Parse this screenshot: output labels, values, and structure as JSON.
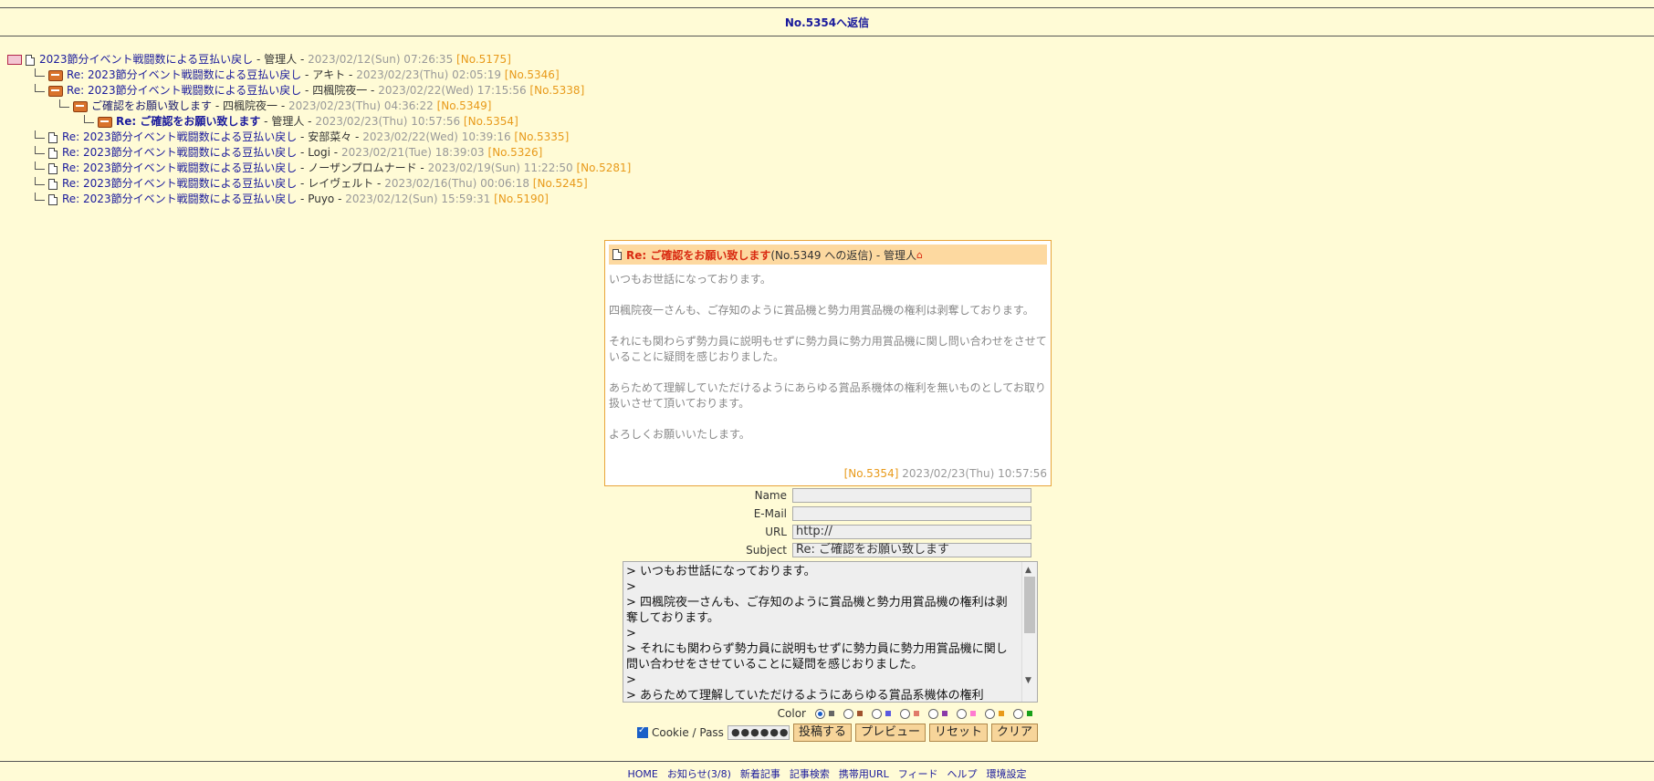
{
  "header": {
    "title": "No.5354へ返信"
  },
  "tree": [
    {
      "indent": 0,
      "icon": "book",
      "subject": "2023節分イベント戦闘数による豆払い戻し",
      "author": "管理人",
      "date": "2023/02/12(Sun) 07:26:35",
      "no": "[No.5175]",
      "style": ""
    },
    {
      "indent": 1,
      "icon": "mail",
      "subject": "Re: 2023節分イベント戦闘数による豆払い戻し",
      "author": "アキト",
      "date": "2023/02/23(Thu) 02:05:19",
      "no": "[No.5346]",
      "style": ""
    },
    {
      "indent": 1,
      "icon": "mail",
      "subject": "Re: 2023節分イベント戦闘数による豆払い戻し",
      "author": "四楓院夜一",
      "date": "2023/02/22(Wed) 17:15:56",
      "no": "[No.5338]",
      "style": ""
    },
    {
      "indent": 2,
      "icon": "mail",
      "subject": "ご確認をお願い致します",
      "author": "四楓院夜一",
      "date": "2023/02/23(Thu) 04:36:22",
      "no": "[No.5349]",
      "style": "plain"
    },
    {
      "indent": 3,
      "icon": "mail",
      "subject": "Re: ご確認をお願い致します",
      "author": "管理人",
      "date": "2023/02/23(Thu) 10:57:56",
      "no": "[No.5354]",
      "style": "cur"
    },
    {
      "indent": 1,
      "icon": "doc",
      "subject": "Re: 2023節分イベント戦闘数による豆払い戻し",
      "author": "安部菜々",
      "date": "2023/02/22(Wed) 10:39:16",
      "no": "[No.5335]",
      "style": ""
    },
    {
      "indent": 1,
      "icon": "doc",
      "subject": "Re: 2023節分イベント戦闘数による豆払い戻し",
      "author": "Logi",
      "date": "2023/02/21(Tue) 18:39:03",
      "no": "[No.5326]",
      "style": ""
    },
    {
      "indent": 1,
      "icon": "doc",
      "subject": "Re: 2023節分イベント戦闘数による豆払い戻し",
      "author": "ノーザンプロムナード",
      "date": "2023/02/19(Sun) 11:22:50",
      "no": "[No.5281]",
      "style": ""
    },
    {
      "indent": 1,
      "icon": "doc",
      "subject": "Re: 2023節分イベント戦闘数による豆払い戻し",
      "author": "レイヴェルト",
      "date": "2023/02/16(Thu) 00:06:18",
      "no": "[No.5245]",
      "style": ""
    },
    {
      "indent": 1,
      "icon": "doc",
      "subject": "Re: 2023節分イベント戦闘数による豆払い戻し",
      "author": "Puyo",
      "date": "2023/02/12(Sun) 15:59:31",
      "no": "[No.5190]",
      "style": ""
    }
  ],
  "article": {
    "subject": "Re: ご確認をお願い致します",
    "meta": " (No.5349 への返信) - 管理人 ",
    "home_icon": "⌂",
    "body": [
      "いつもお世話になっております。",
      "四楓院夜一さんも、ご存知のように賞品機と勢力用賞品機の権利は剥奪しております。",
      "それにも関わらず勢力員に説明もせずに勢力員に勢力用賞品機に関し問い合わせをさせていることに疑問を感じおりました。",
      "あらためて理解していただけるようにあらゆる賞品系機体の権利を無いものとしてお取り扱いさせて頂いております。",
      "よろしくお願いいたします。"
    ],
    "no": "[No.5354]",
    "date": "2023/02/23(Thu) 10:57:56"
  },
  "form": {
    "name_label": "Name",
    "email_label": "E-Mail",
    "url_label": "URL",
    "url_value": "http://",
    "subject_label": "Subject",
    "subject_value": "Re: ご確認をお願い致します",
    "comment_lines": [
      "> いつもお世話になっております。",
      ">",
      "> 四楓院夜一さんも、ご存知のように賞品機と勢力用賞品機の権利は剥奪しております。",
      ">",
      "> それにも関わらず勢力員に説明もせずに勢力員に勢力用賞品機に関し問い合わせをさせていることに疑問を感じおりました。",
      ">",
      "> あらためて理解していただけるようにあらゆる賞品系機体の権利"
    ],
    "color_label": "Color",
    "colors": [
      "#666666",
      "#a0522d",
      "#5a5ae0",
      "#e07a6a",
      "#8a3aa8",
      "#ff7ad0",
      "#e89a1a",
      "#18a018"
    ],
    "cookie_label": "Cookie / Pass",
    "pass_value": "●●●●●●",
    "buttons": {
      "post": "投稿する",
      "preview": "プレビュー",
      "reset": "リセット",
      "clear": "クリア"
    }
  },
  "footer": {
    "items": [
      "HOME",
      "お知らせ(3/8)",
      "新着記事",
      "記事検索",
      "携帯用URL",
      "フィード",
      "ヘルプ",
      "環境設定"
    ]
  }
}
